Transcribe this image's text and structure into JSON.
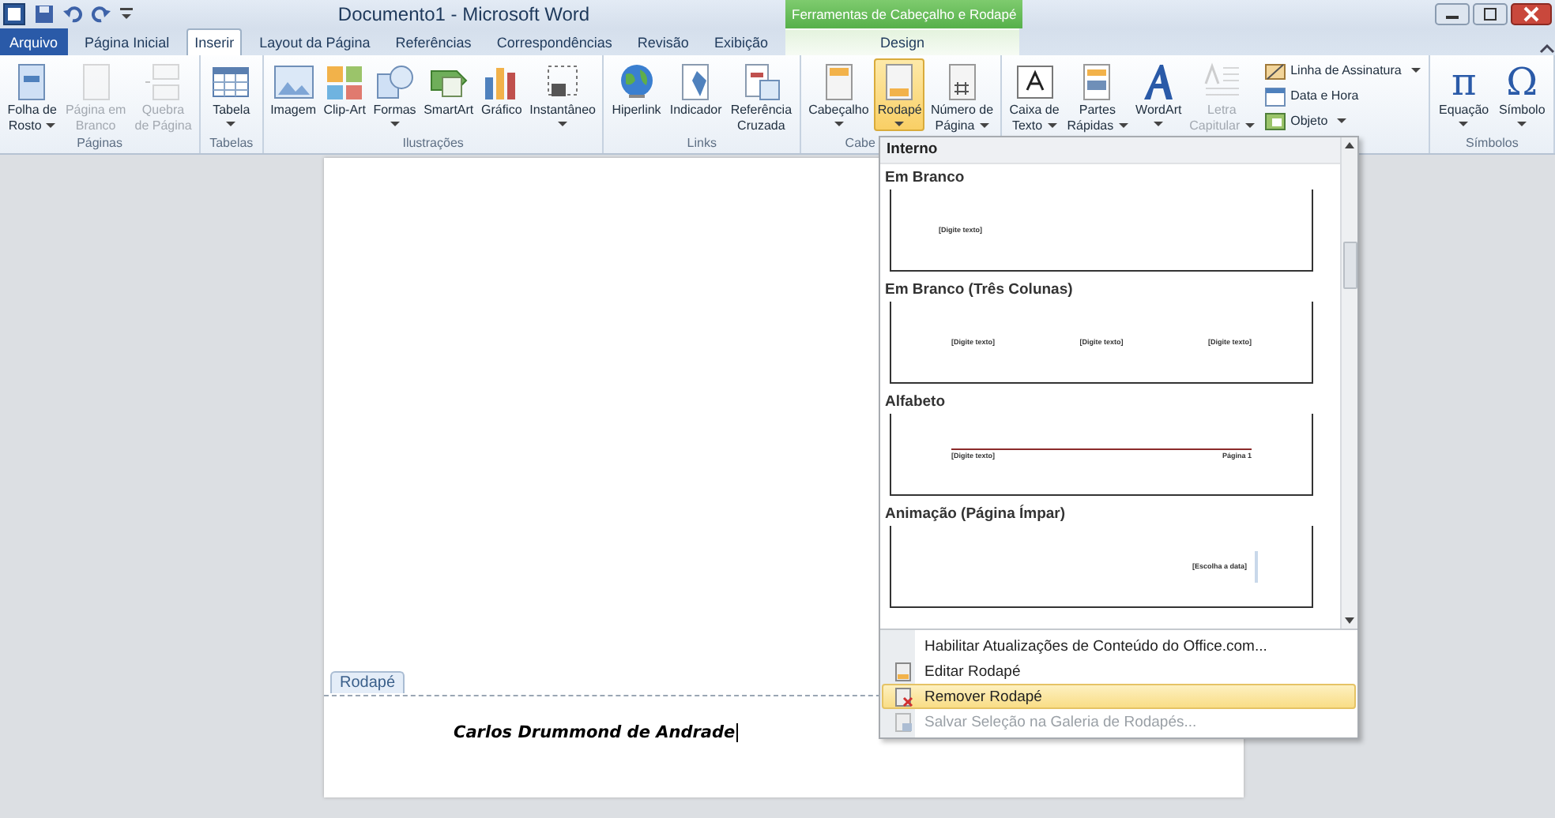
{
  "title_bar": {
    "title": "Documento1 - Microsoft Word",
    "contextual_group": "Ferramentas de Cabeçalho e Rodapé"
  },
  "tabs": [
    {
      "label": "Arquivo",
      "kind": "file",
      "selected": false
    },
    {
      "label": "Página Inicial",
      "kind": "normal",
      "selected": false
    },
    {
      "label": "Inserir",
      "kind": "normal",
      "selected": true
    },
    {
      "label": "Layout da Página",
      "kind": "normal",
      "selected": false
    },
    {
      "label": "Referências",
      "kind": "normal",
      "selected": false
    },
    {
      "label": "Correspondências",
      "kind": "normal",
      "selected": false
    },
    {
      "label": "Revisão",
      "kind": "normal",
      "selected": false
    },
    {
      "label": "Exibição",
      "kind": "normal",
      "selected": false
    },
    {
      "label": "Design",
      "kind": "contextual",
      "selected": false
    }
  ],
  "ribbon": {
    "groups": [
      {
        "label": "Páginas",
        "buttons": [
          {
            "kind": "large",
            "lines": [
              "Folha de",
              "Rosto"
            ],
            "dropdown": true,
            "disabled": false,
            "selected": false
          },
          {
            "kind": "large",
            "lines": [
              "Página em",
              "Branco"
            ],
            "dropdown": false,
            "disabled": true,
            "selected": false
          },
          {
            "kind": "large",
            "lines": [
              "Quebra",
              "de Página"
            ],
            "dropdown": false,
            "disabled": true,
            "selected": false
          }
        ]
      },
      {
        "label": "Tabelas",
        "buttons": [
          {
            "kind": "large",
            "lines": [
              "Tabela"
            ],
            "dropdown": true,
            "disabled": false,
            "selected": false
          }
        ]
      },
      {
        "label": "Ilustrações",
        "buttons": [
          {
            "kind": "large",
            "lines": [
              "Imagem"
            ],
            "dropdown": false,
            "disabled": false,
            "selected": false
          },
          {
            "kind": "large",
            "lines": [
              "Clip-Art"
            ],
            "dropdown": false,
            "disabled": false,
            "selected": false
          },
          {
            "kind": "large",
            "lines": [
              "Formas"
            ],
            "dropdown": true,
            "disabled": false,
            "selected": false
          },
          {
            "kind": "large",
            "lines": [
              "SmartArt"
            ],
            "dropdown": false,
            "disabled": false,
            "selected": false
          },
          {
            "kind": "large",
            "lines": [
              "Gráfico"
            ],
            "dropdown": false,
            "disabled": false,
            "selected": false
          },
          {
            "kind": "large",
            "lines": [
              "Instantâneo"
            ],
            "dropdown": true,
            "disabled": false,
            "selected": false
          }
        ]
      },
      {
        "label": "Links",
        "buttons": [
          {
            "kind": "large",
            "lines": [
              "Hiperlink"
            ],
            "dropdown": false,
            "disabled": false,
            "selected": false
          },
          {
            "kind": "large",
            "lines": [
              "Indicador"
            ],
            "dropdown": false,
            "disabled": false,
            "selected": false
          },
          {
            "kind": "large",
            "lines": [
              "Referência",
              "Cruzada"
            ],
            "dropdown": false,
            "disabled": false,
            "selected": false
          }
        ]
      },
      {
        "label": "Cabe",
        "buttons": [
          {
            "kind": "large",
            "lines": [
              "Cabeçalho"
            ],
            "dropdown": true,
            "disabled": false,
            "selected": false
          },
          {
            "kind": "large",
            "lines": [
              "Rodapé"
            ],
            "dropdown": true,
            "disabled": false,
            "selected": true
          },
          {
            "kind": "large",
            "lines": [
              "Número de",
              "Página"
            ],
            "dropdown": true,
            "disabled": false,
            "selected": false
          }
        ]
      },
      {
        "buttons": [
          {
            "kind": "large",
            "lines": [
              "Caixa de",
              "Texto"
            ],
            "dropdown": true,
            "disabled": false,
            "selected": false
          },
          {
            "kind": "large",
            "lines": [
              "Partes",
              "Rápidas"
            ],
            "dropdown": true,
            "disabled": false,
            "selected": false
          },
          {
            "kind": "large",
            "lines": [
              "WordArt"
            ],
            "dropdown": true,
            "disabled": false,
            "selected": false
          },
          {
            "kind": "large",
            "lines": [
              "Letra",
              "Capitular"
            ],
            "dropdown": true,
            "disabled": true,
            "selected": false
          },
          {
            "kind": "small",
            "lines": [
              "Linha de Assinatura"
            ],
            "dropdown": true,
            "disabled": false,
            "selected": false
          },
          {
            "kind": "small",
            "lines": [
              "Data e Hora"
            ],
            "dropdown": false,
            "disabled": false,
            "selected": false
          },
          {
            "kind": "small",
            "lines": [
              "Objeto"
            ],
            "dropdown": true,
            "disabled": false,
            "selected": false
          }
        ]
      },
      {
        "label": "Símbolos",
        "buttons": [
          {
            "kind": "large",
            "glyph": "π",
            "lines": [
              "Equação"
            ],
            "dropdown": true,
            "disabled": false,
            "selected": false
          },
          {
            "kind": "large",
            "glyph": "Ω",
            "lines": [
              "Símbolo"
            ],
            "dropdown": true,
            "disabled": false,
            "selected": false
          }
        ]
      }
    ]
  },
  "document": {
    "footer_tag": "Rodapé",
    "footer_text": "Carlos Drummond de Andrade"
  },
  "footer_menu": {
    "heading": "Interno",
    "gallery": [
      {
        "title": "Em Branco",
        "kind": "left",
        "texts": [
          "[Digite texto]"
        ]
      },
      {
        "title": "Em Branco (Três Colunas)",
        "kind": "three",
        "texts": [
          "[Digite texto]",
          "[Digite texto]",
          "[Digite texto]"
        ]
      },
      {
        "title": "Alfabeto",
        "kind": "rule",
        "texts": [
          "[Digite texto]",
          "Página 1"
        ]
      },
      {
        "title": "Animação (Página Ímpar)",
        "kind": "date",
        "texts": [
          "[Escolha a data]"
        ]
      }
    ],
    "items": [
      {
        "label": "Habilitar Atualizações de Conteúdo do Office.com...",
        "disabled": false,
        "selected": false
      },
      {
        "label": "Editar Rodapé",
        "disabled": false,
        "selected": false
      },
      {
        "label": "Remover Rodapé",
        "disabled": false,
        "selected": true
      },
      {
        "label": "Salvar Seleção na Galeria de Rodapés...",
        "disabled": true,
        "selected": false
      }
    ]
  }
}
